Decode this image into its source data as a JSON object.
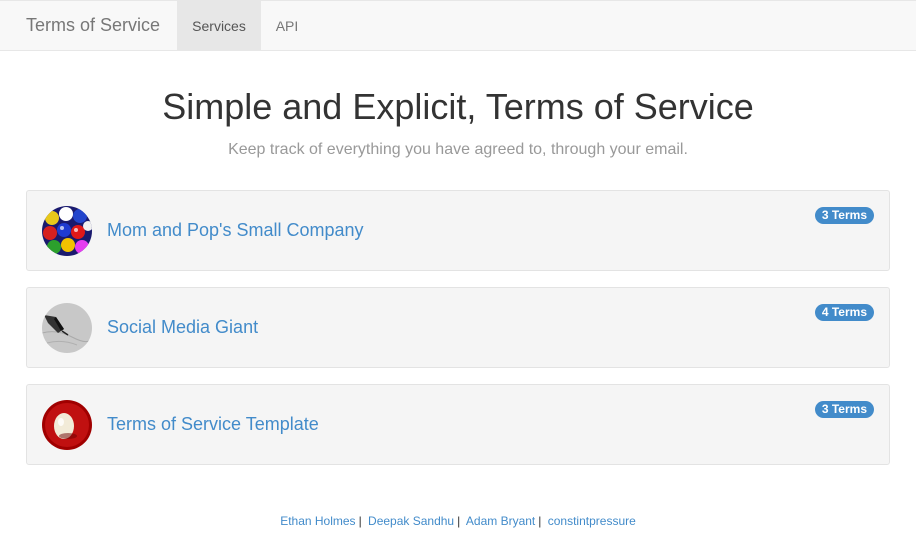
{
  "navbar": {
    "brand": "Terms of Service",
    "items": [
      {
        "label": "Services",
        "active": true
      },
      {
        "label": "API",
        "active": false
      }
    ]
  },
  "hero": {
    "title": "Simple and Explicit, Terms of Service",
    "subtitle": "Keep track of everything you have agreed to, through your email."
  },
  "services": [
    {
      "name": "Mom and Pop's Small Company",
      "badge": "3 Terms",
      "avatar_icon": "gumballs-avatar"
    },
    {
      "name": "Social Media Giant",
      "badge": "4 Terms",
      "avatar_icon": "pen-writing-avatar"
    },
    {
      "name": "Terms of Service Template",
      "badge": "3 Terms",
      "avatar_icon": "egg-on-red-avatar"
    }
  ],
  "footer": {
    "links": [
      "Ethan Holmes",
      "Deepak Sandhu",
      "Adam Bryant",
      "constintpressure"
    ],
    "separator": "|"
  },
  "colors": {
    "link": "#428bca",
    "badge_bg": "#428bca",
    "card_bg": "#f5f5f5",
    "navbar_bg": "#f8f8f8"
  }
}
